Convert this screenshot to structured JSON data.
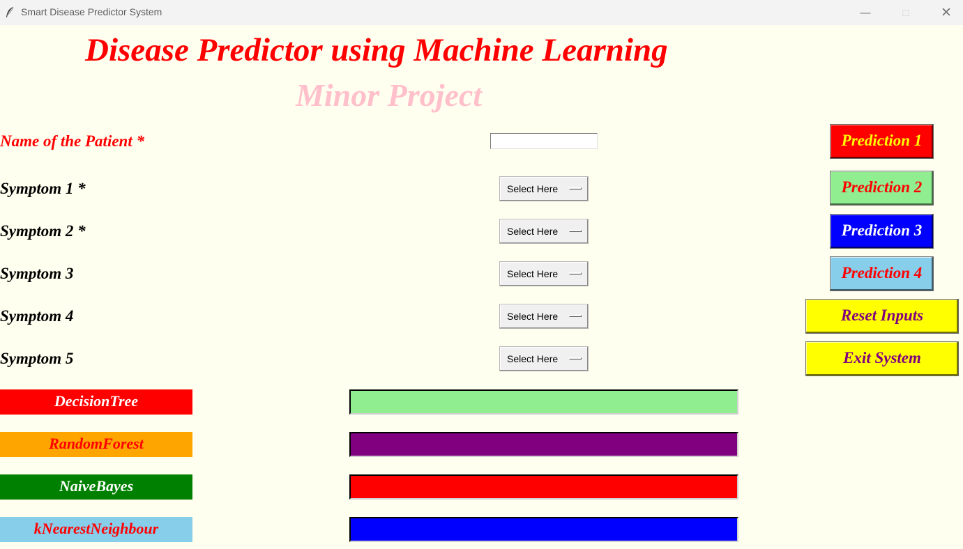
{
  "window": {
    "title": "Smart Disease Predictor System"
  },
  "header": {
    "title": "Disease Predictor using Machine Learning",
    "subtitle": "Minor Project"
  },
  "form": {
    "name_label": "Name of the Patient *",
    "name_value": "",
    "symptoms": [
      {
        "label": "Symptom 1 *",
        "selected": "Select Here"
      },
      {
        "label": "Symptom 2 *",
        "selected": "Select Here"
      },
      {
        "label": "Symptom 3",
        "selected": "Select Here"
      },
      {
        "label": "Symptom 4",
        "selected": "Select Here"
      },
      {
        "label": "Symptom 5",
        "selected": "Select Here"
      }
    ]
  },
  "algorithms": [
    {
      "label": "DecisionTree",
      "bg": "#ff0000",
      "fg": "#ffffff",
      "result": "",
      "result_bg": "#90ee90"
    },
    {
      "label": "RandomForest",
      "bg": "#ffa500",
      "fg": "#ff0000",
      "result": "",
      "result_bg": "#800080"
    },
    {
      "label": "NaiveBayes",
      "bg": "#008000",
      "fg": "#ffffff",
      "result": "",
      "result_bg": "#ff0000"
    },
    {
      "label": "kNearestNeighbour",
      "bg": "#87ceeb",
      "fg": "#ff0000",
      "result": "",
      "result_bg": "#0000ff"
    }
  ],
  "buttons": {
    "prediction_1": "Prediction 1",
    "prediction_2": "Prediction 2",
    "prediction_3": "Prediction 3",
    "prediction_4": "Prediction 4",
    "reset": "Reset Inputs",
    "exit": "Exit System"
  },
  "colors": {
    "background": "#fffff0",
    "accent": "#ff0000",
    "subtitle": "#ffc0cb",
    "yellow": "#ffff00",
    "purple": "#800080"
  }
}
